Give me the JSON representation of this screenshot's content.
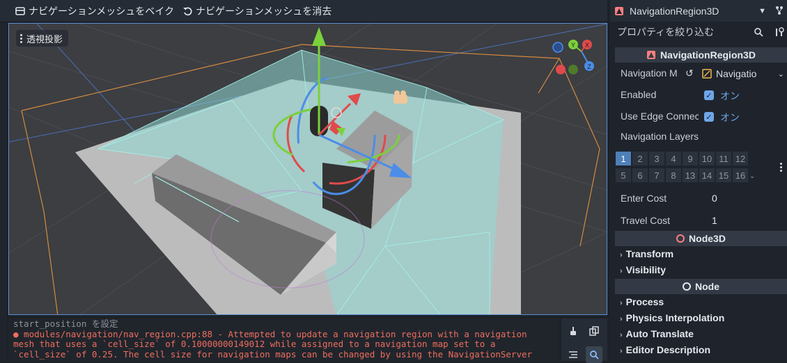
{
  "toolbar": {
    "bake_label": "ナビゲーションメッシュをベイク",
    "clear_label": "ナビゲーションメッシュを消去"
  },
  "viewport": {
    "perspective_label": "透視投影",
    "gizmo_axes": {
      "x": "X",
      "y": "Y",
      "z": "Z"
    }
  },
  "output": {
    "lines": [
      {
        "text": "start_position を設定",
        "kind": "info"
      },
      {
        "text": "● modules/navigation/nav_region.cpp:88 - Attempted to update a navigation region with a navigation",
        "kind": "error"
      },
      {
        "text": "mesh that uses a `cell_size` of 0.10000000149012 while assigned to a navigation map set to a",
        "kind": "error"
      },
      {
        "text": "`cell_size` of 0.25. The cell size for navigation maps can be changed by using the NavigationServer",
        "kind": "error"
      }
    ]
  },
  "inspector": {
    "node_selector": "NavigationRegion3D",
    "filter_placeholder": "プロパティを絞り込む",
    "class_header": "NavigationRegion3D",
    "properties": {
      "navigation_mesh_label": "Navigation M",
      "navigation_mesh_value": "Navigatio",
      "enabled_label": "Enabled",
      "enabled_value": "オン",
      "use_edge_label": "Use Edge Connec",
      "use_edge_value": "オン",
      "nav_layers_label": "Navigation Layers",
      "layers_row1": [
        "1",
        "2",
        "3",
        "4",
        "9",
        "10",
        "11",
        "12"
      ],
      "layers_row2": [
        "5",
        "6",
        "7",
        "8",
        "13",
        "14",
        "15",
        "16"
      ],
      "enter_cost_label": "Enter Cost",
      "enter_cost_value": "0",
      "travel_cost_label": "Travel Cost",
      "travel_cost_value": "1"
    },
    "node3d_header": "Node3D",
    "node3d_groups": [
      "Transform",
      "Visibility"
    ],
    "node_header": "Node",
    "node_groups": [
      "Process",
      "Physics Interpolation",
      "Auto Translate",
      "Editor Description"
    ]
  },
  "colors": {
    "accent_blue": "#6fa6e8",
    "navmesh": "#7fe0d8",
    "error_text": "#ef6d5e",
    "node3d_icon": "#fc7f7f"
  }
}
